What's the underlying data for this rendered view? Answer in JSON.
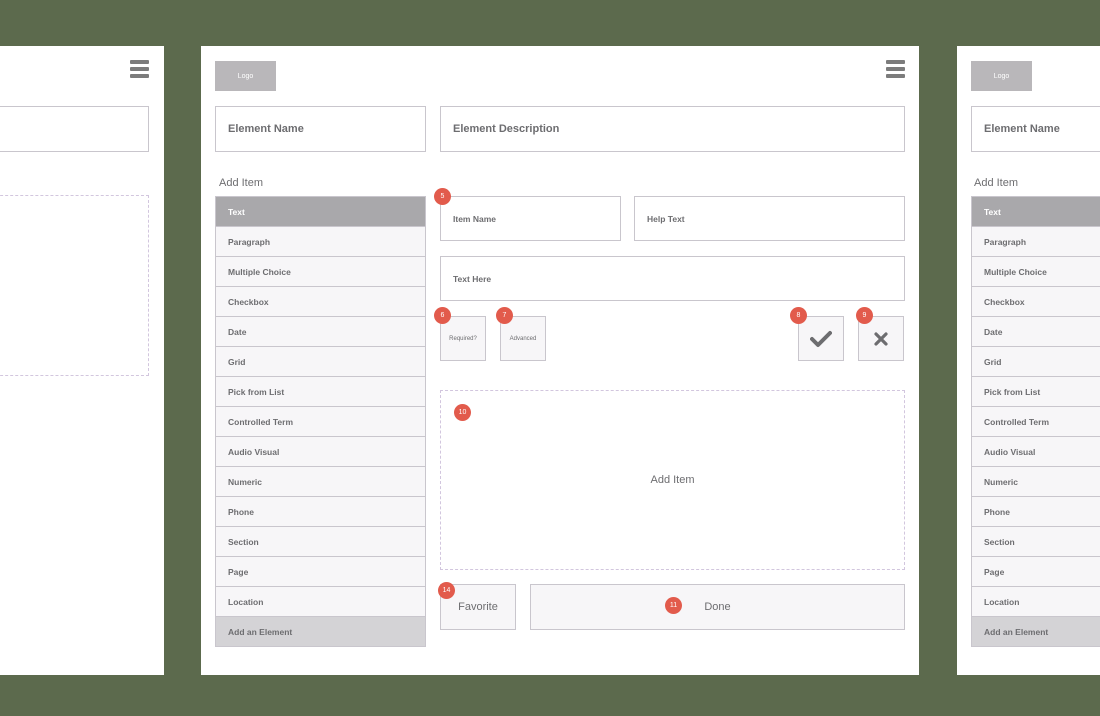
{
  "common": {
    "logo": "Logo",
    "element_name_placeholder": "Element Name",
    "add_item_label": "Add Item"
  },
  "main": {
    "element_description_placeholder": "Element Description",
    "item_name_placeholder": "Item Name",
    "help_text_placeholder": "Help Text",
    "text_here_placeholder": "Text Here",
    "required_label": "Required?",
    "advanced_label": "Advanced",
    "drop_zone_label": "Add Item",
    "favorite_button": "Favorite",
    "done_button": "Done",
    "badges": {
      "item_name": "5",
      "required": "6",
      "advanced": "7",
      "confirm": "8",
      "cancel": "9",
      "drop_zone": "10",
      "done": "11",
      "favorite": "14"
    }
  },
  "item_types": [
    "Text",
    "Paragraph",
    "Multiple Choice",
    "Checkbox",
    "Date",
    "Grid",
    "Pick from List",
    "Controlled Term",
    "Audio Visual",
    "Numeric",
    "Phone",
    "Section",
    "Page",
    "Location",
    "Add an Element"
  ],
  "colors": {
    "background": "#5c6a4d",
    "badge": "#e25b4c",
    "active_item": "#a9a8ab"
  }
}
